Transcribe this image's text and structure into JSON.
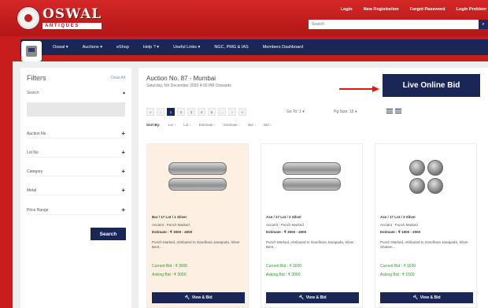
{
  "header": {
    "logo_name": "OSWAL",
    "logo_sub": "ANTIQUES",
    "links": [
      "Login",
      "New Registration",
      "Forgot Password",
      "Login Problem"
    ],
    "search_placeholder": "Search"
  },
  "nav": {
    "items": [
      "Oswal ▾",
      "Auctions ▾",
      "eShop",
      "Help ? ▾",
      "Useful Links ▾",
      "NGC, PMG & IAS",
      "Members Dashboard"
    ]
  },
  "sidebar": {
    "title": "Filters",
    "clear_all": "Clear All",
    "search_label": "Search",
    "filters": [
      "Auction No",
      "Lot No",
      "Category",
      "Metal",
      "Price Range"
    ],
    "search_button": "Search"
  },
  "main": {
    "auction_title": "Auction No. 87 - Mumbai",
    "auction_date": "Saturday, 5th December 2020 4:00 PM Onwards",
    "live_bid": "Live Online Bid",
    "pager": [
      "«",
      "‹",
      "1",
      "2",
      "3",
      "4",
      "5",
      "...",
      "›",
      "»"
    ],
    "goto": "Go To: 1 ▾",
    "pgsize": "Pg Size: 15 ▾",
    "sort_label": "Sort By:",
    "sort_options": [
      "Lot ↑",
      "Lot ↓",
      "Estimate ↑",
      "Estimate ↓",
      "Bid ↑",
      "Bid ↓"
    ]
  },
  "cards": [
    {
      "lot": "Bar / 17 Lot / 1 Silver",
      "category": "Ancient : Punch Marked",
      "estimate": "Estimate : ₹ 3000 - 4000",
      "desc": "Punch Marked, Attributed to Gandhara Janapada, Silver Bent...",
      "current_bid": "Current Bid : ₹ 3000",
      "asking_bid": "Asking Bid : ₹ 3000",
      "view_label": "View & Bid",
      "image": "bent-bar-coins"
    },
    {
      "lot": "Axe / 17 Lot / 2 Silver",
      "category": "Ancient : Punch Marked",
      "estimate": "Estimate : ₹ 3000 - 4000",
      "desc": "Punch Marked, Attributed to Gandhara Janapada, Silver Bent...",
      "current_bid": "Current Bid : ₹ 3000",
      "asking_bid": "Asking Bid : ₹ 3000",
      "view_label": "View & Bid",
      "image": "bent-bar-coins"
    },
    {
      "lot": "Axe / 17 Lot / 3 Silver",
      "category": "Ancient : Punch Marked",
      "estimate": "Estimate : ₹ 1500 - 2000",
      "desc": "Punch Marked, Attributed to Gandhara Janapada, Silver Shatam...",
      "current_bid": "Current Bid : ₹ 1500",
      "asking_bid": "Asking Bid : ₹ 1500",
      "view_label": "View & Bid",
      "image": "round-coins"
    }
  ]
}
